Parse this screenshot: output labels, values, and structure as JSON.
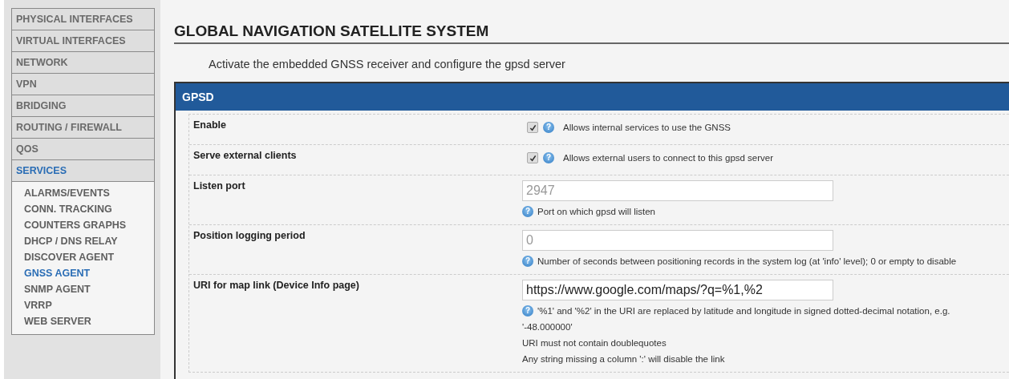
{
  "sidebar": {
    "items": [
      {
        "label": "PHYSICAL INTERFACES",
        "selected": false
      },
      {
        "label": "VIRTUAL INTERFACES",
        "selected": false
      },
      {
        "label": "NETWORK",
        "selected": false
      },
      {
        "label": "VPN",
        "selected": false
      },
      {
        "label": "BRIDGING",
        "selected": false
      },
      {
        "label": "ROUTING / FIREWALL",
        "selected": false
      },
      {
        "label": "QOS",
        "selected": false
      },
      {
        "label": "SERVICES",
        "selected": true,
        "children": [
          {
            "label": "ALARMS/EVENTS",
            "selected": false
          },
          {
            "label": "CONN. TRACKING",
            "selected": false
          },
          {
            "label": "COUNTERS GRAPHS",
            "selected": false
          },
          {
            "label": "DHCP / DNS RELAY",
            "selected": false
          },
          {
            "label": "DISCOVER AGENT",
            "selected": false
          },
          {
            "label": "GNSS AGENT",
            "selected": true
          },
          {
            "label": "SNMP AGENT",
            "selected": false
          },
          {
            "label": "VRRP",
            "selected": false
          },
          {
            "label": "WEB SERVER",
            "selected": false
          }
        ]
      }
    ]
  },
  "page": {
    "title": "GLOBAL NAVIGATION SATELLITE SYSTEM",
    "description": "Activate the embedded GNSS receiver and configure the gpsd server"
  },
  "panel": {
    "title": "GPSD",
    "rows": [
      {
        "kind": "checkbox",
        "label": "Enable",
        "checked": true,
        "icon": "?",
        "help": "Allows internal services to use the GNSS"
      },
      {
        "kind": "checkbox",
        "label": "Serve external clients",
        "checked": true,
        "icon": "?",
        "help": "Allows external users to connect to this gpsd server"
      },
      {
        "kind": "text",
        "label": "Listen port",
        "placeholder": "2947",
        "icon": "?",
        "help": "Port on which gpsd will listen"
      },
      {
        "kind": "text",
        "label": "Position logging period",
        "placeholder": "0",
        "icon": "?",
        "help": "Number of seconds between positioning records in the system log (at 'info' level); 0 or empty to disable"
      },
      {
        "kind": "text",
        "label": "URI for map link (Device Info page)",
        "icon": "?",
        "value": "https://www.google.com/maps/?q=%1,%2",
        "help": "'%1' and '%2' in the URI are replaced by latitude and longitude in signed dotted-decimal notation, e.g.",
        "notes": [
          "'-48.000000'",
          "URI must not contain doublequotes",
          "Any string missing a column ':' will disable the link"
        ]
      }
    ]
  }
}
